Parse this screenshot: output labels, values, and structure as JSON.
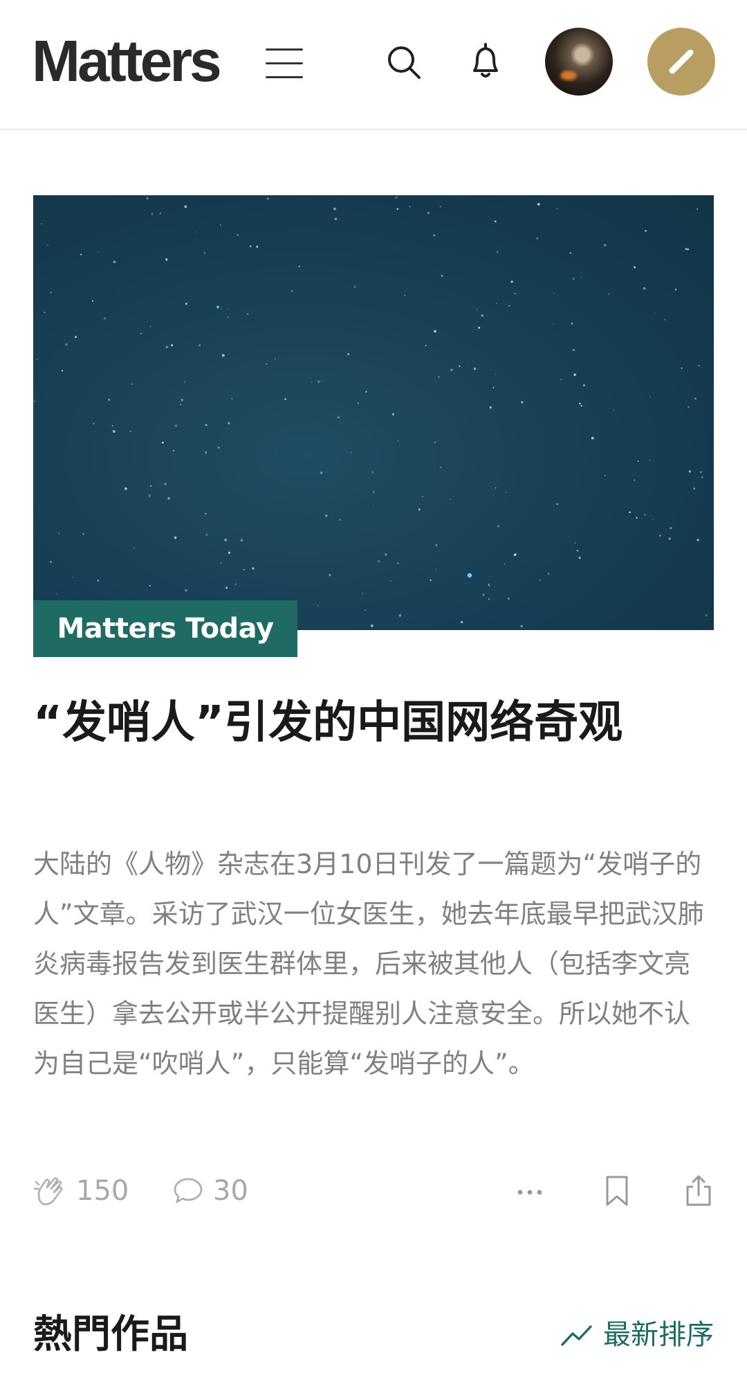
{
  "header": {
    "logo": "Matters"
  },
  "hero_article": {
    "tag": "Matters  Today",
    "title": "“发哨人”引发的中国网络奇观",
    "summary": "大陆的《人物》杂志在3月10日刊发了一篇题为“发哨子的人”文章。采访了武汉一位女医生，她去年底最早把武汉肺炎病毒报告发到医生群体里，后来被其他人（包括李文亮医生）拿去公开或半公开提醒别人注意安全。所以她不认为自己是“吹哨人”，只能算“发哨子的人”。",
    "stats": {
      "claps": "150",
      "comments": "30"
    }
  },
  "hot_section": {
    "title": "熱門作品",
    "sort_label": "最新排序"
  },
  "colors": {
    "accent_green": "#1f6b63",
    "compose_gold": "#b89e62",
    "muted_text": "#808080"
  },
  "icons": [
    "menu-icon",
    "search-icon",
    "bell-icon",
    "pencil-icon",
    "clap-icon",
    "comment-icon",
    "more-icon",
    "bookmark-icon",
    "share-icon",
    "trending-icon"
  ]
}
